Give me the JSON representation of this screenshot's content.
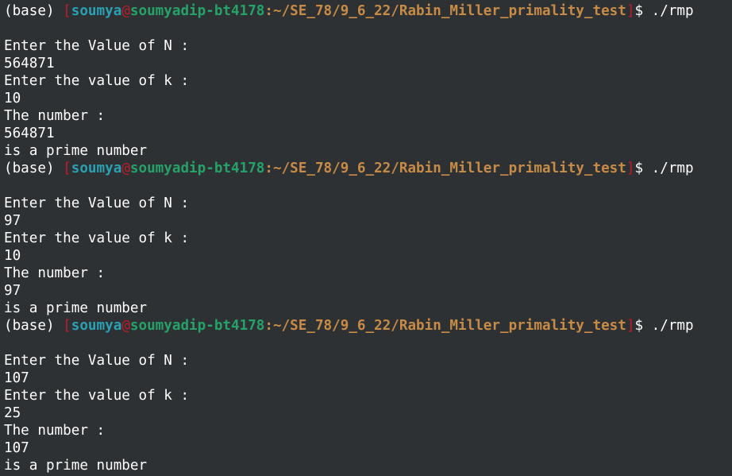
{
  "colors": {
    "background": "#2d3134",
    "foreground": "#ffffff",
    "bracket": "#c01c28",
    "user": "#2aa1b3",
    "host": "#26a269",
    "path": "#c88b46"
  },
  "prompt": {
    "env": "(base)",
    "open_bracket": "[",
    "user": "soumya",
    "at": "@",
    "host": "soumyadip-bt4178",
    "path": ":~/SE_78/9_6_22/Rabin_Miller_primality_test",
    "close_bracket": "]",
    "symbol": "$"
  },
  "sessions": [
    {
      "command": "./rmp",
      "output": [
        "",
        "Enter the Value of N :",
        "564871",
        "Enter the value of k :",
        "10",
        "The number :",
        "564871",
        "is a prime number"
      ]
    },
    {
      "command": "./rmp",
      "output": [
        "",
        "Enter the Value of N :",
        "97",
        "Enter the value of k :",
        "10",
        "The number :",
        "97",
        "is a prime number"
      ]
    },
    {
      "command": "./rmp",
      "output": [
        "",
        "Enter the Value of N :",
        "107",
        "Enter the value of k :",
        "25",
        "The number :",
        "107",
        "is a prime number"
      ]
    }
  ]
}
